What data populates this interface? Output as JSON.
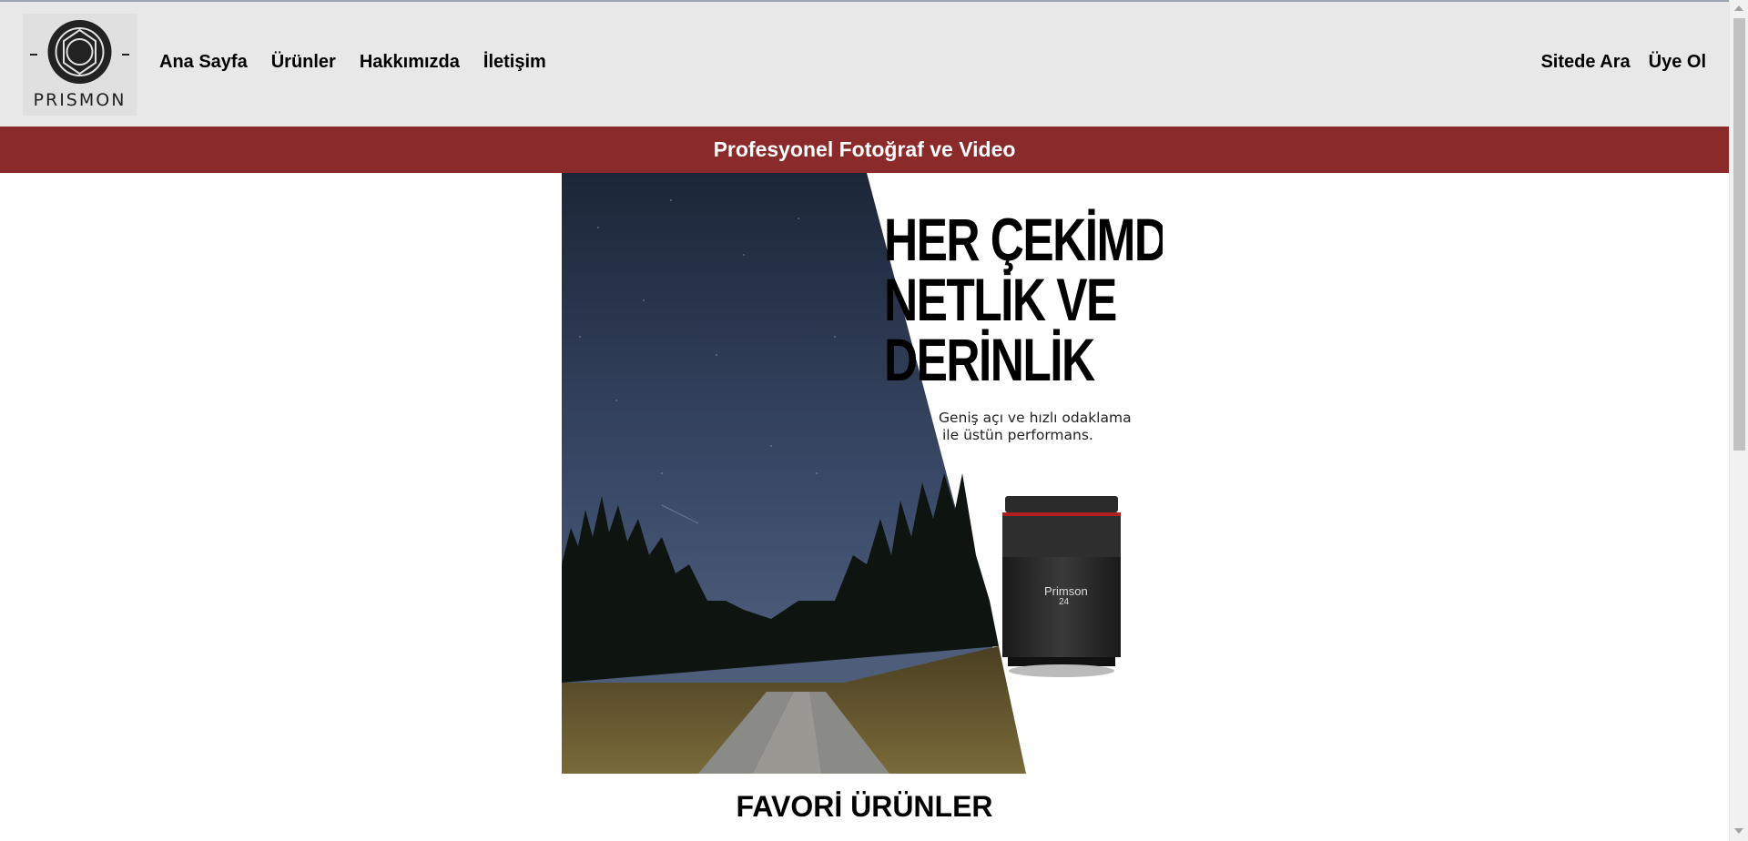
{
  "brand": {
    "name": "PRISMON"
  },
  "nav": {
    "links": [
      "Ana Sayfa",
      "Ürünler",
      "Hakkımızda",
      "İletişim"
    ],
    "search_label": "Sitede Ara",
    "signup_label": "Üye Ol"
  },
  "banner": {
    "text": "Profesyonel Fotoğraf ve Video"
  },
  "hero": {
    "headline": [
      "HER ÇEKİMDE",
      "NETLİK VE",
      "DERİNLİK"
    ],
    "subtext": [
      "Geniş açı ve hızlı odaklama",
      "ile üstün performans."
    ],
    "lens_brand": "Primson",
    "lens_number": "24"
  },
  "sections": {
    "favorites_title": "FAVORİ ÜRÜNLER"
  },
  "colors": {
    "accent": "#8b2a2b",
    "navbar_bg": "#e8e8e8"
  }
}
